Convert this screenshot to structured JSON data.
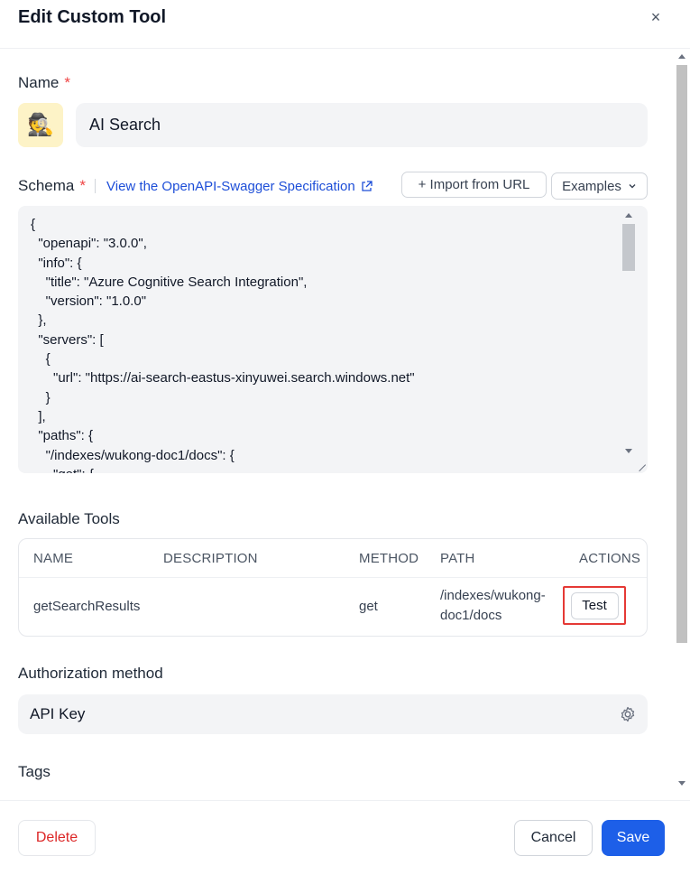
{
  "dialog": {
    "title": "Edit Custom Tool",
    "close_icon": "×"
  },
  "name_section": {
    "label": "Name",
    "required_mark": "*",
    "value": "AI Search",
    "icon": "detective-emoji",
    "icon_glyph": "🕵"
  },
  "schema_section": {
    "label": "Schema",
    "required_mark": "*",
    "spec_link": "View the OpenAPI-Swagger Specification",
    "import_button": "+ Import from URL",
    "examples_button": "Examples",
    "code": "{\n  \"openapi\": \"3.0.0\",\n  \"info\": {\n    \"title\": \"Azure Cognitive Search Integration\",\n    \"version\": \"1.0.0\"\n  },\n  \"servers\": [\n    {\n      \"url\": \"https://ai-search-eastus-xinyuwei.search.windows.net\"\n    }\n  ],\n  \"paths\": {\n    \"/indexes/wukong-doc1/docs\": {\n      \"get\": {\n        \"operationId\": \"getSearchResults\","
  },
  "tools_section": {
    "label": "Available Tools",
    "columns": {
      "name": "NAME",
      "description": "DESCRIPTION",
      "method": "METHOD",
      "path": "PATH",
      "actions": "ACTIONS"
    },
    "rows": [
      {
        "name": "getSearchResults",
        "description": "",
        "method": "get",
        "path_line1": "/indexes/wukong-",
        "path_line2": "doc1/docs",
        "action": "Test"
      }
    ]
  },
  "auth_section": {
    "label": "Authorization method",
    "value": "API Key"
  },
  "tags_section": {
    "label": "Tags"
  },
  "footer": {
    "delete": "Delete",
    "cancel": "Cancel",
    "save": "Save"
  },
  "colors": {
    "primary": "#1d5fe8",
    "danger": "#dc2626",
    "highlight": "#e53935"
  }
}
